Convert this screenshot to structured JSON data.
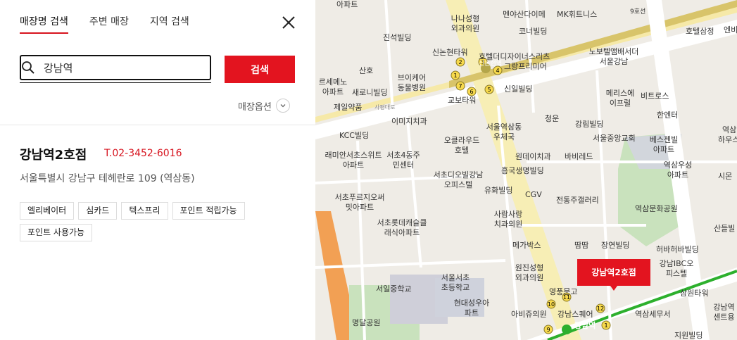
{
  "tabs": [
    {
      "label": "매장명 검색"
    },
    {
      "label": "주변 매장"
    },
    {
      "label": "지역 검색"
    }
  ],
  "search": {
    "value": "강남역",
    "button_label": "검색"
  },
  "options": {
    "label": "매장옵션"
  },
  "store": {
    "name": "강남역2호점",
    "phone": "T.02-3452-6016",
    "address": "서울특별시 강남구 테헤란로 109 (역삼동)",
    "badges": [
      "엘리베이터",
      "심카드",
      "텍스프리",
      "포인트 적립가능",
      "포인트 사용가능"
    ]
  },
  "map": {
    "marker_label": "강남역2호점",
    "labels": [
      "아파트",
      "나나성형외과의원",
      "멘야산다이메",
      "MK휘트니스",
      "9호선",
      "호텔삼정",
      "진석빌딩",
      "코너빌딩",
      "신논현타워",
      "호텔더디자이너스리츠",
      "노보텔앰배서더서울강남",
      "산호",
      "브이케어동물병원",
      "신논현역",
      "그랑프리미어",
      "르세메노아파트",
      "새로니빌딩",
      "신일빌딩",
      "메리스에이프럴",
      "비트로스",
      "제일약품",
      "교보타워",
      "사평대로",
      "청운",
      "한엔터",
      "이미지치과",
      "서울역삼동우체국",
      "강림빌딩",
      "KCC빌딩",
      "오클라우드호텔",
      "서울중앙교회",
      "베스젠빌아파트",
      "래미안서초스위트아파트",
      "서초4동주민센터",
      "원데이치과",
      "바비레드",
      "흥국생명빌딩",
      "역삼우성아파트",
      "서초디오빌강남오피스텔",
      "유화빌딩",
      "CGV",
      "서초푸르지오써밋아파트",
      "전통주갤러리",
      "역삼문화공원",
      "사람사랑치과의원",
      "서초롯데캐슬클래식아파트",
      "메가박스",
      "땀땀",
      "장연빌딩",
      "허바허바빌딩",
      "강남IBC오피스텔",
      "원진성형외과의원",
      "서일중학교",
      "서울서초초등학교",
      "영풍문고",
      "삼원타워",
      "현대성우아파트",
      "아비쥬의원",
      "강남스퀘어",
      "역삼세무서",
      "강남역",
      "명달공원",
      "강남역센트용",
      "지원빌딩",
      "산들빌",
      "시몬",
      "역삼",
      "엔비",
      "하우스"
    ]
  }
}
